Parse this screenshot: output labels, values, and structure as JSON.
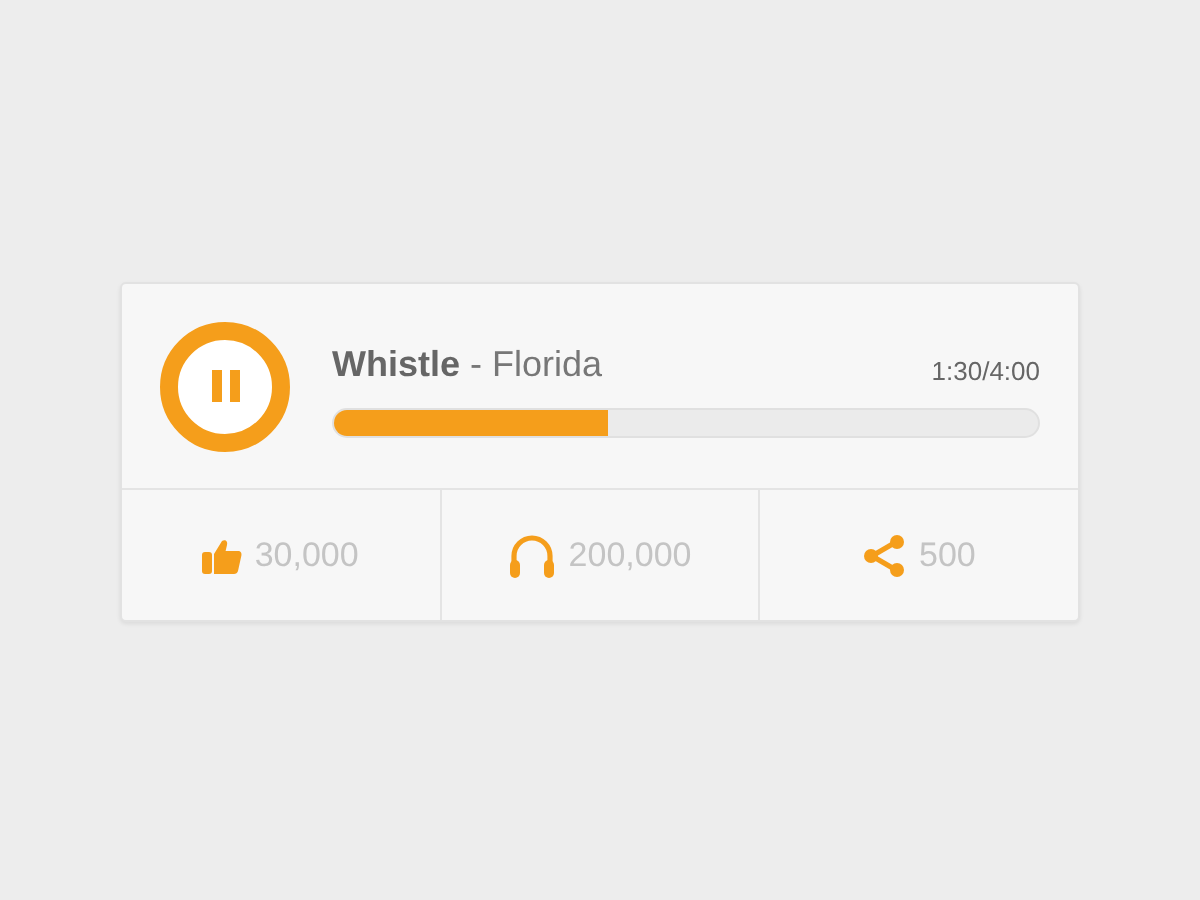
{
  "player": {
    "playing": true,
    "title": "**Whistle** - Florida",
    "time": "1:30/4:00",
    "level": 0.39
  },
  "stats": [
    {
      "kind": "like",
      "count": "30,000"
    },
    {
      "kind": "listens",
      "count": "200,000"
    },
    {
      "kind": "share",
      "count": "500"
    }
  ]
}
